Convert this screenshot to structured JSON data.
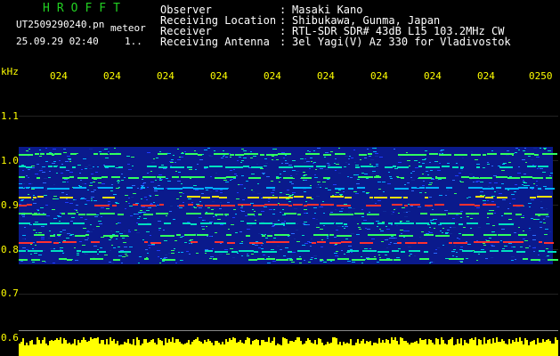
{
  "header": {
    "brand": "HROFFT",
    "filename": "UT2509290240.pn",
    "tag": "meteor",
    "datetime": "25.09.29 02:40",
    "count": "1..",
    "rows": [
      {
        "label": "Observer",
        "sep": ":",
        "value": "Masaki Kano"
      },
      {
        "label": "Receiving Location",
        "sep": ":",
        "value": "Shibukawa, Gunma, Japan"
      },
      {
        "label": "Receiver",
        "sep": ":",
        "value": "RTL-SDR SDR# 43dB L15 103.2MHz CW"
      },
      {
        "label": "Receiving Antenna",
        "sep": ":",
        "value": "3el Yagi(V) Az 330 for Vladivostok"
      }
    ]
  },
  "axes": {
    "unit": "kHz",
    "y_ticks": [
      "1.1",
      "1.0",
      "0.9",
      "0.8",
      "0.7",
      "0.6"
    ],
    "time_ticks": [
      "024",
      "024",
      "024",
      "024",
      "024",
      "024",
      "024",
      "024",
      "024",
      "0250"
    ]
  },
  "colors": {
    "brand": "#22d022",
    "axis_text": "#ffff00",
    "signal_bar": "#ffff00",
    "background": "#000000",
    "spectrogram_base": "#0a1a8c"
  }
}
